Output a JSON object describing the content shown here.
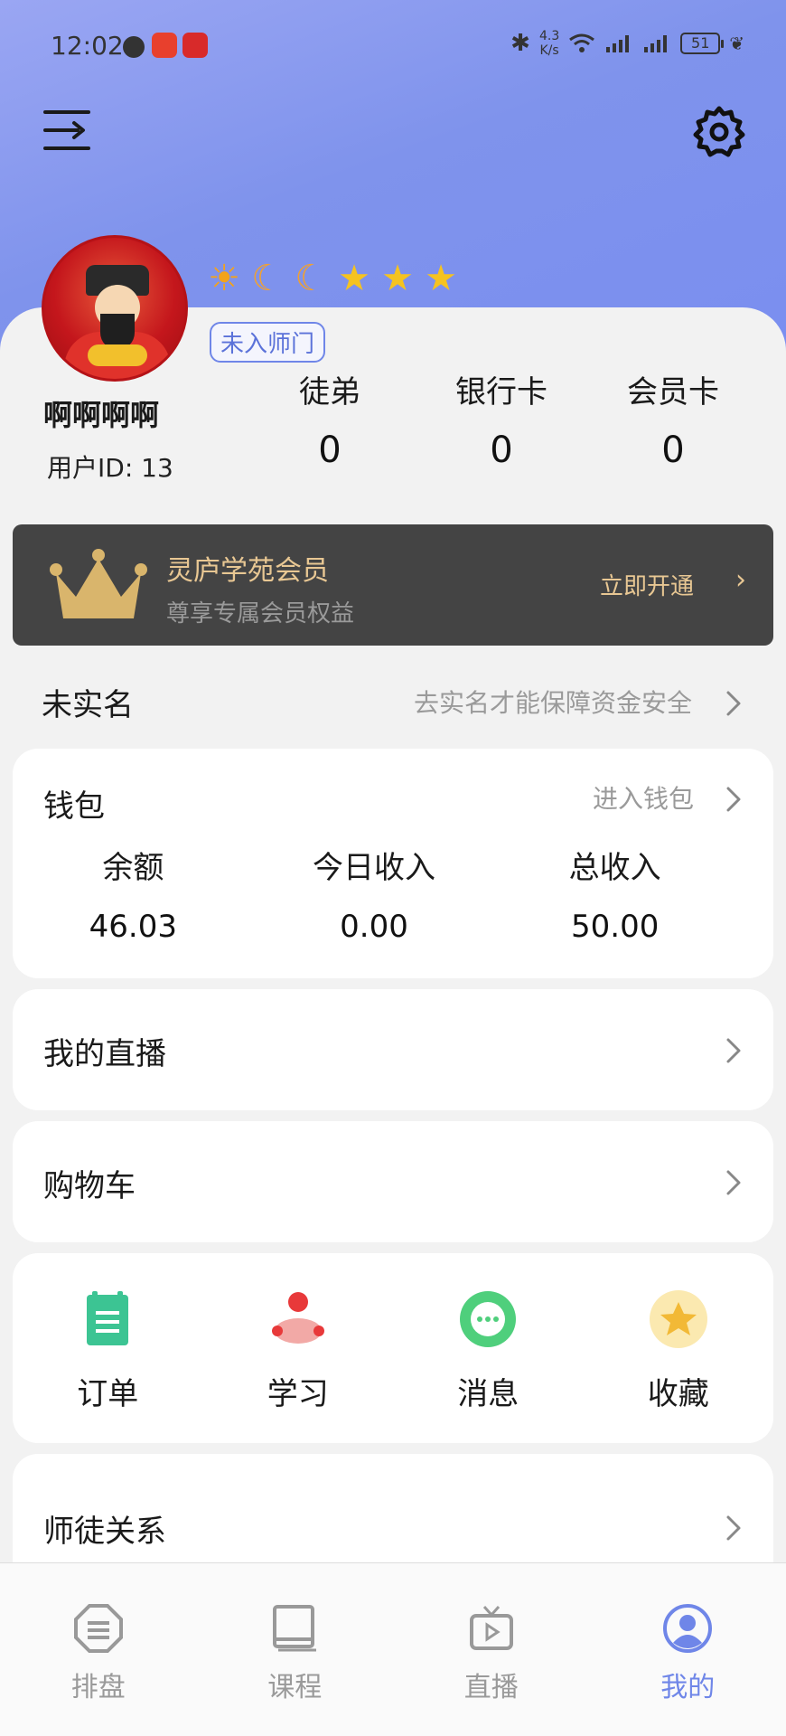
{
  "status_bar": {
    "time": "12:02",
    "net_speed_value": "4.3",
    "net_speed_unit": "K/s",
    "battery": "51"
  },
  "profile": {
    "username": "啊啊啊啊",
    "user_id_label": "用户ID:",
    "user_id": "13",
    "rank_tag": "未入师门",
    "badges": [
      "sun",
      "moon",
      "moon",
      "star",
      "star",
      "star"
    ]
  },
  "stats": [
    {
      "label": "徒弟",
      "value": "0"
    },
    {
      "label": "银行卡",
      "value": "0"
    },
    {
      "label": "会员卡",
      "value": "0"
    }
  ],
  "vip": {
    "title": "灵庐学苑会员",
    "subtitle": "尊享专属会员权益",
    "cta": "立即开通"
  },
  "verification": {
    "status": "未实名",
    "hint": "去实名才能保障资金安全"
  },
  "wallet": {
    "title": "钱包",
    "link": "进入钱包",
    "columns": [
      {
        "label": "余额",
        "value": "46.03"
      },
      {
        "label": "今日收入",
        "value": "0.00"
      },
      {
        "label": "总收入",
        "value": "50.00"
      }
    ]
  },
  "rows": {
    "live": "我的直播",
    "cart": "购物车",
    "mentor": "师徒关系"
  },
  "shortcuts": [
    {
      "label": "订单",
      "icon": "clipboard-icon",
      "color": "#3cc493"
    },
    {
      "label": "学习",
      "icon": "study-icon",
      "color": "#f0605e"
    },
    {
      "label": "消息",
      "icon": "chat-icon",
      "color": "#4fcf7c"
    },
    {
      "label": "收藏",
      "icon": "star-icon",
      "color": "#f5c542"
    }
  ],
  "tabs": [
    {
      "label": "排盘",
      "icon": "layout-icon"
    },
    {
      "label": "课程",
      "icon": "book-icon"
    },
    {
      "label": "直播",
      "icon": "tv-icon"
    },
    {
      "label": "我的",
      "icon": "user-icon",
      "active": true
    }
  ],
  "colors": {
    "accent": "#6f86e8",
    "hero_gradient_start": "#9aa6f3",
    "hero_gradient_end": "#7a8ef0",
    "vip_bg": "#444444",
    "vip_gold": "#e8c793"
  }
}
